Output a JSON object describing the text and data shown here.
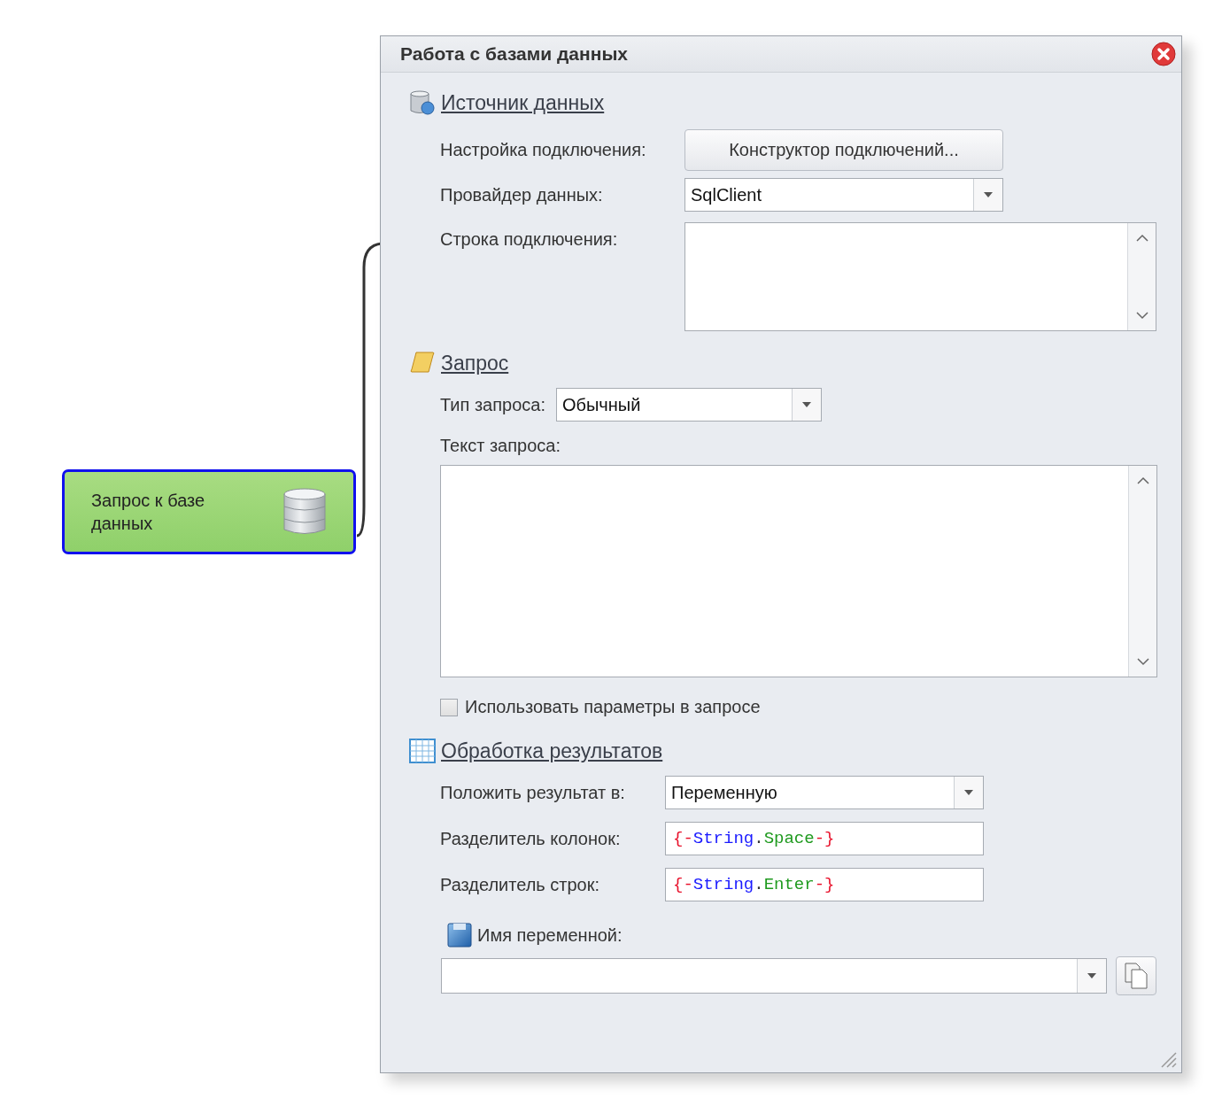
{
  "node": {
    "label": "Запрос к базе данных",
    "selected": true
  },
  "panel": {
    "title": "Работа с базами данных"
  },
  "source": {
    "heading": "Источник данных",
    "connection_label": "Настройка подключения:",
    "connection_button": "Конструктор подключений...",
    "provider_label": "Провайдер данных:",
    "provider_value": "SqlClient",
    "connection_string_label": "Строка подключения:"
  },
  "query": {
    "heading": "Запрос",
    "type_label": "Тип запроса:",
    "type_value": "Обычный",
    "text_label": "Текст запроса:",
    "use_params": {
      "label": "Использовать параметры в запросе",
      "checked": false
    }
  },
  "results": {
    "heading": "Обработка результатов",
    "put_label": "Положить результат в:",
    "put_value": "Переменную",
    "separators": [
      {
        "label": "Разделитель колонок:",
        "tokens": [
          {
            "kind": "brace",
            "text": "{-"
          },
          {
            "kind": "object",
            "text": "String"
          },
          {
            "kind": "dot",
            "text": "."
          },
          {
            "kind": "member",
            "text": "Space"
          },
          {
            "kind": "brace",
            "text": "-}"
          }
        ]
      },
      {
        "label": "Разделитель строк:",
        "tokens": [
          {
            "kind": "brace",
            "text": "{-"
          },
          {
            "kind": "object",
            "text": "String"
          },
          {
            "kind": "dot",
            "text": "."
          },
          {
            "kind": "member",
            "text": "Enter"
          },
          {
            "kind": "brace",
            "text": "-}"
          }
        ]
      }
    ],
    "variable_label": "Имя переменной:"
  }
}
